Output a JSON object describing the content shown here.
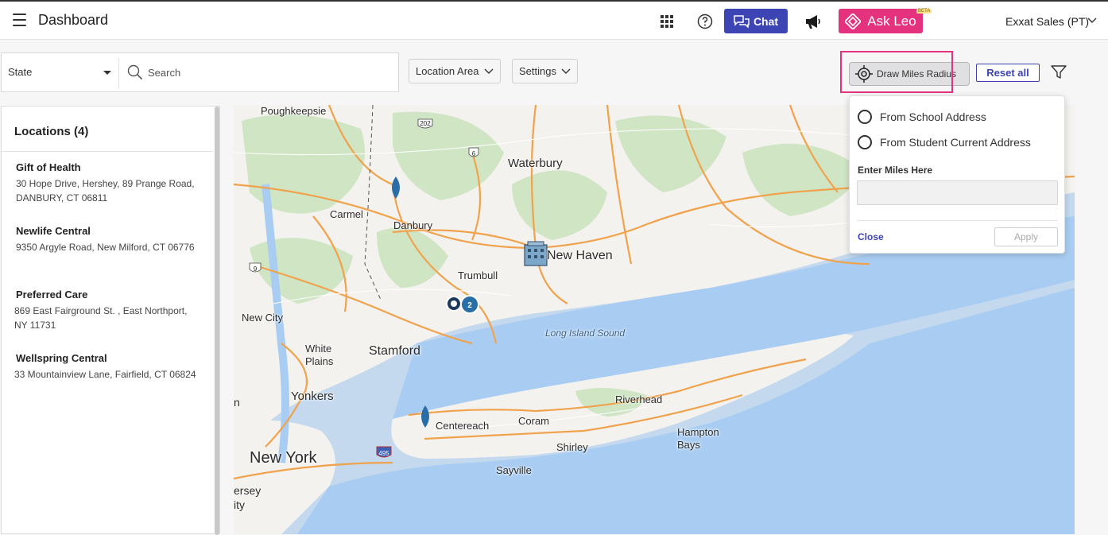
{
  "header": {
    "title": "Dashboard",
    "chat_label": "Chat",
    "askleo_label": "Ask Leo",
    "beta_label": "BETA",
    "user_name": "Exxat Sales (PT)"
  },
  "toolbar": {
    "state_label": "State",
    "search_placeholder": "Search",
    "location_area_label": "Location Area",
    "settings_label": "Settings",
    "draw_radius_label": "Draw Miles Radius",
    "reset_label": "Reset all"
  },
  "sidebar": {
    "title": "Locations (4)",
    "items": [
      {
        "name": "Gift of Health",
        "address": "30 Hope Drive, Hershey, 89 Prange Road, DANBURY, CT 06811"
      },
      {
        "name": "Newlife Central",
        "address": "9350 Argyle Road, New Milford, CT 06776"
      },
      {
        "name": "Preferred Care",
        "address": "869 East Fairground St. , East Northport, NY 11731"
      },
      {
        "name": "Wellspring Central",
        "address": "33 Mountainview Lane, Fairfield, CT 06824"
      }
    ]
  },
  "popup": {
    "option_school": "From School Address",
    "option_student": "From Student Current Address",
    "miles_label": "Enter Miles Here",
    "miles_value": "",
    "close_label": "Close",
    "apply_label": "Apply"
  },
  "map": {
    "labels": {
      "poughkeepsie": "Poughkeepsie",
      "waterbury": "Waterbury",
      "carmel": "Carmel",
      "danbury": "Danbury",
      "new_haven": "New Haven",
      "trumbull": "Trumbull",
      "new_city": "New City",
      "white_plains": "White Plains",
      "stamford": "Stamford",
      "long_island_sound": "Long Island Sound",
      "yonkers": "Yonkers",
      "riverhead": "Riverhead",
      "coram": "Coram",
      "centereach": "Centereach",
      "hampton_bays": "Hampton Bays",
      "shirley": "Shirley",
      "new_york": "New York",
      "sayville": "Sayville",
      "jersey": "ersey",
      "city": "ity",
      "edge_n": "n"
    },
    "shields": {
      "r202": "202",
      "r6": "6",
      "r9": "9",
      "i495": "495"
    },
    "cluster_count": "2",
    "colors": {
      "water": "#a9cdf2",
      "land": "#f4f2ee",
      "forest": "#cfe5c4",
      "highway": "#f0a24c",
      "marker": "#2a6ea8"
    }
  }
}
